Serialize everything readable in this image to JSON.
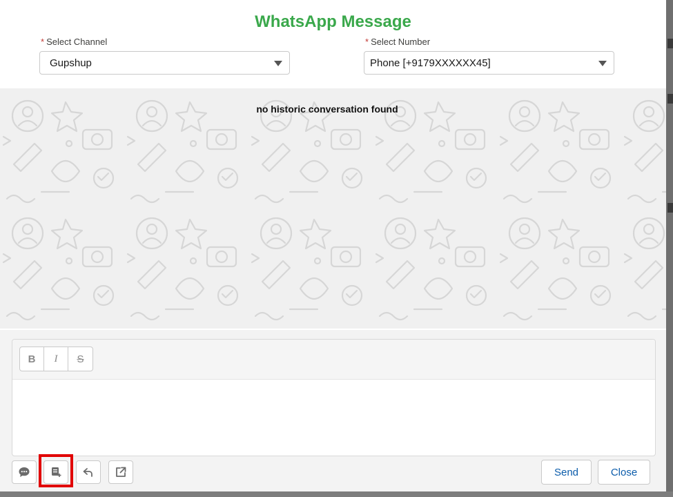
{
  "modal": {
    "title": "WhatsApp Message"
  },
  "channel": {
    "label": "Select Channel",
    "required_mark": "*",
    "value": "Gupshup"
  },
  "number": {
    "label": "Select Number",
    "required_mark": "*",
    "value": "Phone [+9179XXXXXX45]"
  },
  "conversation": {
    "empty_text": "no historic conversation found"
  },
  "editor": {
    "format_buttons": [
      "B",
      "I",
      "S"
    ]
  },
  "toolbar_icons": [
    "chat-bubble-icon",
    "quick-text-icon",
    "reply-icon",
    "open-external-icon"
  ],
  "actions": {
    "send_label": "Send",
    "close_label": "Close"
  },
  "colors": {
    "title": "#3aa84b",
    "required": "#c23934",
    "button_text": "#0b5cab",
    "highlight": "#e10000"
  }
}
